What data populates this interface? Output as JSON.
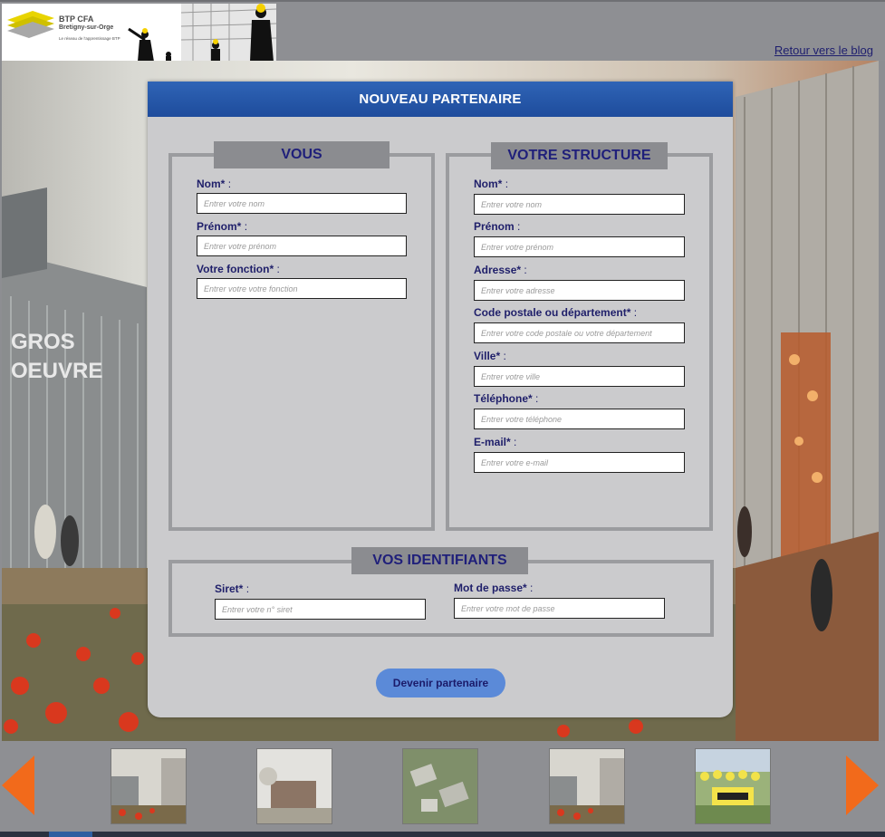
{
  "header": {
    "logo_title": "BTP CFA",
    "logo_subtitle": "Bretigny-sur-Orge",
    "logo_tagline": "Le réseau de l'apprentissage BTP",
    "back_link": "Retour vers le blog"
  },
  "hero": {
    "building_sign": "GROS OEUVRE"
  },
  "form": {
    "title": "NOUVEAU PARTENAIRE",
    "vous": {
      "legend": "VOUS",
      "fields": [
        {
          "label": "Nom*",
          "placeholder": "Entrer votre nom"
        },
        {
          "label": "Prénom*",
          "placeholder": "Entrer votre prénom"
        },
        {
          "label": "Votre fonction*",
          "placeholder": "Entrer votre votre fonction"
        }
      ]
    },
    "structure": {
      "legend": "VOTRE STRUCTURE",
      "fields": [
        {
          "label": "Nom*",
          "placeholder": "Entrer votre nom"
        },
        {
          "label": "Prénom",
          "placeholder": "Entrer votre prénom"
        },
        {
          "label": "Adresse*",
          "placeholder": "Entrer votre adresse"
        },
        {
          "label": "Code postale ou département*",
          "placeholder": "Entrer votre code postale ou votre département"
        },
        {
          "label": "Ville*",
          "placeholder": "Entrer votre ville"
        },
        {
          "label": "Téléphone*",
          "placeholder": "Entrer votre téléphone"
        },
        {
          "label": "E-mail*",
          "placeholder": "Entrer votre e-mail"
        }
      ]
    },
    "identifiants": {
      "legend": "VOS IDENTIFIANTS",
      "siret": {
        "label": "Siret*",
        "placeholder": "Entrer votre n° siret"
      },
      "password": {
        "label": "Mot de passe*",
        "placeholder": "Entrer votre mot de passe"
      }
    },
    "colon": ":",
    "submit_label": "Devenir partenaire"
  },
  "carousel": {
    "prev_icon": "arrow-left-icon",
    "next_icon": "arrow-right-icon",
    "thumbnails": [
      "rendering-courtyard",
      "rendering-building-fog",
      "rendering-aerial",
      "rendering-courtyard",
      "group-photo-banner"
    ]
  },
  "colors": {
    "accent_blue": "#2f64b6",
    "legend_text": "#1f1f7a",
    "arrow_orange": "#f26a1b"
  }
}
